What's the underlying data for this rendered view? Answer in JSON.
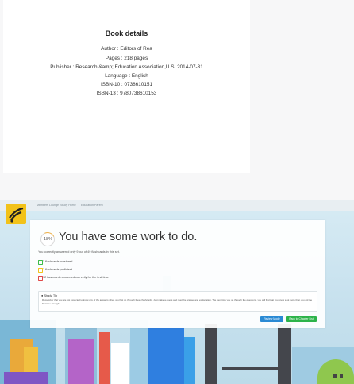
{
  "book": {
    "title": "Book details",
    "author": "Author : Editors of Rea",
    "pages": "Pages : 218 pages",
    "publisher": "Publisher : Research &amp; Education Association,U.S. 2014-07-31",
    "language": "Language : English",
    "isbn10": "ISBN-10 : 0738610151",
    "isbn13": "ISBN-13 : 9780738610153"
  },
  "app": {
    "breadcrumb": [
      "Members Lounge",
      "Study Home",
      "Education Parent"
    ],
    "progress_percent": "18%",
    "progress_fraction": 0.18,
    "headline": "You have some work to do.",
    "summary": "You correctly answered only 9 out of 49 flashcards in this set.",
    "stats": [
      {
        "label": "2 flashcards mastered",
        "color": "#3dbb4a"
      },
      {
        "label": "7 flashcards proficient",
        "color": "#f2c21a"
      },
      {
        "label": "12 flashcards answered correctly for the first time",
        "color": "#e04848"
      }
    ],
    "tip": {
      "title": "Study Tip",
      "text": "Remember that you are not expected to know any of the answers when you first go through these flashcards. Just make a guess and read the answer and explanation. The next time you go through the questions, you will find that you know a lot more than you did the first time through."
    },
    "buttons": {
      "review": "Review Mode",
      "back": "Back to Chapter List"
    }
  }
}
